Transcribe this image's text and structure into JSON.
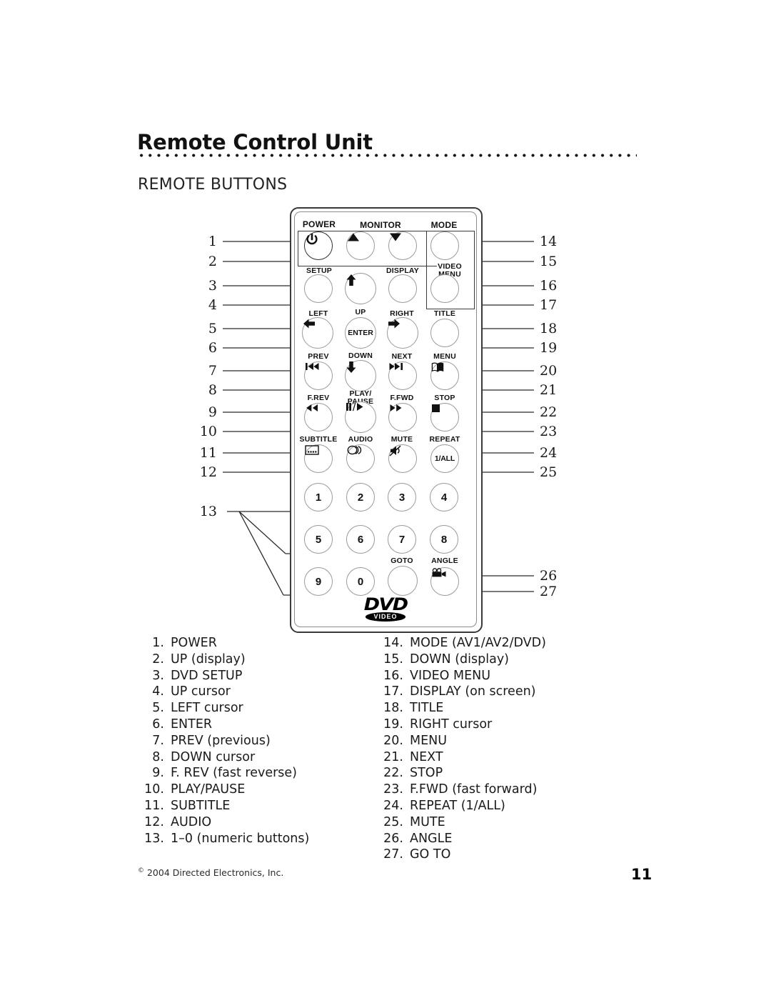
{
  "header": {
    "title": "Remote Control Unit",
    "section": "REMOTE BUTTONS"
  },
  "remote": {
    "logo_top": "DVD",
    "logo_bottom": "VIDEO",
    "labels": {
      "power": "POWER",
      "monitor": "MONITOR",
      "mode": "MODE",
      "setup": "SETUP",
      "display": "DISPLAY",
      "video_menu_line1": "VIDEO",
      "video_menu_line2": "MENU",
      "left": "LEFT",
      "up": "UP",
      "right": "RIGHT",
      "title": "TITLE",
      "enter": "ENTER",
      "prev": "PREV",
      "down": "DOWN",
      "next": "NEXT",
      "menu": "MENU",
      "frev": "F.REV",
      "playpause_line1": "PLAY/",
      "playpause_line2": "PAUSE",
      "ffwd": "F.FWD",
      "stop": "STOP",
      "subtitle": "SUBTITLE",
      "audio": "AUDIO",
      "mute": "MUTE",
      "repeat": "REPEAT",
      "repeat_value": "1/ALL",
      "goto": "GOTO",
      "angle": "ANGLE"
    },
    "numeric_keys": [
      "1",
      "2",
      "3",
      "4",
      "5",
      "6",
      "7",
      "8",
      "9",
      "0"
    ]
  },
  "callouts_left": [
    "1",
    "2",
    "3",
    "4",
    "5",
    "6",
    "7",
    "8",
    "9",
    "10",
    "11",
    "12",
    "13"
  ],
  "callouts_right": [
    "14",
    "15",
    "16",
    "17",
    "18",
    "19",
    "20",
    "21",
    "22",
    "23",
    "24",
    "25",
    "26",
    "27"
  ],
  "legend_left": [
    {
      "n": "1.",
      "text": "POWER"
    },
    {
      "n": "2.",
      "text": "UP (display)"
    },
    {
      "n": "3.",
      "text": "DVD SETUP"
    },
    {
      "n": "4.",
      "text": "UP cursor"
    },
    {
      "n": "5.",
      "text": "LEFT cursor"
    },
    {
      "n": "6.",
      "text": "ENTER"
    },
    {
      "n": "7.",
      "text": "PREV (previous)"
    },
    {
      "n": "8.",
      "text": "DOWN cursor"
    },
    {
      "n": "9.",
      "text": "F. REV (fast reverse)"
    },
    {
      "n": "10.",
      "text": "PLAY/PAUSE"
    },
    {
      "n": "11.",
      "text": "SUBTITLE"
    },
    {
      "n": "12.",
      "text": "AUDIO"
    },
    {
      "n": "13.",
      "text": "1–0 (numeric buttons)"
    }
  ],
  "legend_right": [
    {
      "n": "14.",
      "text": "MODE (AV1/AV2/DVD)"
    },
    {
      "n": "15.",
      "text": "DOWN (display)"
    },
    {
      "n": "16.",
      "text": "VIDEO MENU"
    },
    {
      "n": "17.",
      "text": "DISPLAY (on screen)"
    },
    {
      "n": "18.",
      "text": "TITLE"
    },
    {
      "n": "19.",
      "text": "RIGHT cursor"
    },
    {
      "n": "20.",
      "text": "MENU"
    },
    {
      "n": "21.",
      "text": "NEXT"
    },
    {
      "n": "22.",
      "text": "STOP"
    },
    {
      "n": "23.",
      "text": "F.FWD (fast forward)"
    },
    {
      "n": "24.",
      "text": "REPEAT (1/ALL)"
    },
    {
      "n": "25.",
      "text": "MUTE"
    },
    {
      "n": "26.",
      "text": "ANGLE"
    },
    {
      "n": "27.",
      "text": "GO TO"
    }
  ],
  "footer": {
    "copyright_mark": "©",
    "copyright": "2004 Directed Electronics, Inc.",
    "page": "11"
  }
}
